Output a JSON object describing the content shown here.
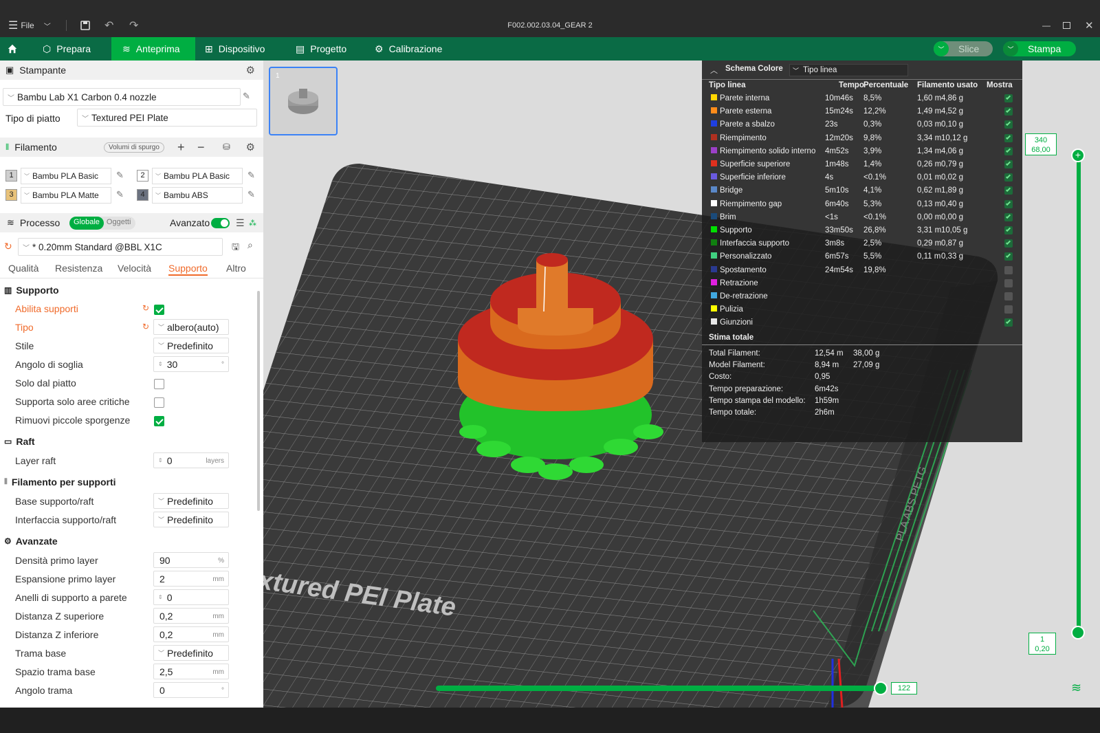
{
  "window": {
    "title": "F002.002.03.04_GEAR 2",
    "file_menu": "File"
  },
  "nav": {
    "tabs": [
      {
        "label": "Prepara",
        "icon": "cube-icon"
      },
      {
        "label": "Anteprima",
        "icon": "layers-icon",
        "active": true
      },
      {
        "label": "Dispositivo",
        "icon": "device-icon"
      },
      {
        "label": "Progetto",
        "icon": "project-icon"
      },
      {
        "label": "Calibrazione",
        "icon": "calibration-icon"
      }
    ],
    "slice_label": "Slice",
    "print_label": "Stampa"
  },
  "printer": {
    "section_title": "Stampante",
    "name": "Bambu Lab X1 Carbon 0.4 nozzle",
    "plate_label": "Tipo di piatto",
    "plate_value": "Textured PEI Plate"
  },
  "filament": {
    "section_title": "Filamento",
    "purge_label": "Volumi di spurgo",
    "slots": [
      {
        "num": "1",
        "name": "Bambu PLA Basic",
        "color": "#cfcfcf"
      },
      {
        "num": "2",
        "name": "Bambu PLA Basic",
        "color": "#ffffff"
      },
      {
        "num": "3",
        "name": "Bambu PLA Matte",
        "color": "#e8c27a"
      },
      {
        "num": "4",
        "name": "Bambu ABS",
        "color": "#6b7280"
      }
    ]
  },
  "process": {
    "section_title": "Processo",
    "toggle_global": "Globale",
    "toggle_objects": "Oggetti",
    "advanced_label": "Avanzato",
    "profile": "* 0.20mm Standard @BBL X1C",
    "tabs": [
      "Qualità",
      "Resistenza",
      "Velocità",
      "Supporto",
      "Altro"
    ],
    "active_tab": "Supporto"
  },
  "settings": {
    "supporto": {
      "title": "Supporto",
      "abilita": "Abilita supporti",
      "tipo": "Tipo",
      "tipo_value": "albero(auto)",
      "stile": "Stile",
      "stile_value": "Predefinito",
      "angolo": "Angolo di soglia",
      "angolo_value": "30",
      "angolo_unit": "°",
      "solo_piatto": "Solo dal piatto",
      "solo_critiche": "Supporta solo aree critiche",
      "rimuovi": "Rimuovi piccole sporgenze"
    },
    "raft": {
      "title": "Raft",
      "layer": "Layer raft",
      "layer_value": "0",
      "layer_unit": "layers"
    },
    "filamento_supporti": {
      "title": "Filamento per supporti",
      "base": "Base supporto/raft",
      "base_value": "Predefinito",
      "interfaccia": "Interfaccia supporto/raft",
      "interfaccia_value": "Predefinito"
    },
    "avanzate": {
      "title": "Avanzate",
      "densita": "Densità primo layer",
      "densita_value": "90",
      "densita_unit": "%",
      "espansione": "Espansione primo layer",
      "espansione_value": "2",
      "espansione_unit": "mm",
      "anelli": "Anelli di supporto a parete",
      "anelli_value": "0",
      "dist_sup": "Distanza Z superiore",
      "dist_sup_value": "0,2",
      "dist_sup_unit": "mm",
      "dist_inf": "Distanza Z inferiore",
      "dist_inf_value": "0,2",
      "dist_inf_unit": "mm",
      "trama": "Trama base",
      "trama_value": "Predefinito",
      "spazio": "Spazio trama base",
      "spazio_value": "2,5",
      "spazio_unit": "mm",
      "angolo_trama": "Angolo trama",
      "angolo_trama_value": "0",
      "angolo_trama_unit": "°"
    }
  },
  "viewport": {
    "plate_thumb_number": "1",
    "plate_text": "xtured PEI Plate",
    "plate_side_text": "PLA ABS PETG",
    "vslider_top": "340",
    "vslider_top_sub": "68,00",
    "vslider_bottom": "1",
    "vslider_bottom_sub": "0,20",
    "hslider_value": "122"
  },
  "legend": {
    "title": "Schema Colore",
    "mode": "Tipo linea",
    "headers": [
      "Tipo linea",
      "Tempo",
      "Percentuale",
      "Filamento usato",
      "Mostra"
    ],
    "rows": [
      {
        "name": "Parete interna",
        "color": "#ffd700",
        "time": "10m46s",
        "pct": "8,5%",
        "m": "1,60 m",
        "g": "4,86 g",
        "show": true
      },
      {
        "name": "Parete esterna",
        "color": "#ff8c1a",
        "time": "15m24s",
        "pct": "12,2%",
        "m": "1,49 m",
        "g": "4,52 g",
        "show": true
      },
      {
        "name": "Parete a sbalzo",
        "color": "#1f3fe0",
        "time": "23s",
        "pct": "0,3%",
        "m": "0,03 m",
        "g": "0,10 g",
        "show": true
      },
      {
        "name": "Riempimento",
        "color": "#b03020",
        "time": "12m20s",
        "pct": "9,8%",
        "m": "3,34 m",
        "g": "10,12 g",
        "show": true
      },
      {
        "name": "Riempimento solido interno",
        "color": "#9b40c8",
        "time": "4m52s",
        "pct": "3,9%",
        "m": "1,34 m",
        "g": "4,06 g",
        "show": true
      },
      {
        "name": "Superficie superiore",
        "color": "#e0301e",
        "time": "1m48s",
        "pct": "1,4%",
        "m": "0,26 m",
        "g": "0,79 g",
        "show": true
      },
      {
        "name": "Superficie inferiore",
        "color": "#6a5ae0",
        "time": "4s",
        "pct": "<0.1%",
        "m": "0,01 m",
        "g": "0,02 g",
        "show": true
      },
      {
        "name": "Bridge",
        "color": "#5a88c8",
        "time": "5m10s",
        "pct": "4,1%",
        "m": "0,62 m",
        "g": "1,89 g",
        "show": true
      },
      {
        "name": "Riempimento gap",
        "color": "#ffffff",
        "time": "6m40s",
        "pct": "5,3%",
        "m": "0,13 m",
        "g": "0,40 g",
        "show": true
      },
      {
        "name": "Brim",
        "color": "#1a4a7a",
        "time": "<1s",
        "pct": "<0.1%",
        "m": "0,00 m",
        "g": "0,00 g",
        "show": true
      },
      {
        "name": "Supporto",
        "color": "#00e000",
        "time": "33m50s",
        "pct": "26,8%",
        "m": "3,31 m",
        "g": "10,05 g",
        "show": true
      },
      {
        "name": "Interfaccia supporto",
        "color": "#108010",
        "time": "3m8s",
        "pct": "2,5%",
        "m": "0,29 m",
        "g": "0,87 g",
        "show": true
      },
      {
        "name": "Personalizzato",
        "color": "#40d080",
        "time": "6m57s",
        "pct": "5,5%",
        "m": "0,11 m",
        "g": "0,33 g",
        "show": true
      },
      {
        "name": "Spostamento",
        "color": "#2a3a90",
        "time": "24m54s",
        "pct": "19,8%",
        "m": "",
        "g": "",
        "show": false
      },
      {
        "name": "Retrazione",
        "color": "#e020e0",
        "time": "",
        "pct": "",
        "m": "",
        "g": "",
        "show": false
      },
      {
        "name": "De-retrazione",
        "color": "#40a8e0",
        "time": "",
        "pct": "",
        "m": "",
        "g": "",
        "show": false
      },
      {
        "name": "Pulizia",
        "color": "#ffff00",
        "time": "",
        "pct": "",
        "m": "",
        "g": "",
        "show": false
      },
      {
        "name": "Giunzioni",
        "color": "#e8e8e8",
        "time": "",
        "pct": "",
        "m": "",
        "g": "",
        "show": true
      }
    ],
    "totals_title": "Stima totale",
    "totals": [
      {
        "label": "Total Filament:",
        "v1": "12,54 m",
        "v2": "38,00 g"
      },
      {
        "label": "Model Filament:",
        "v1": "8,94 m",
        "v2": "27,09 g"
      },
      {
        "label": "Costo:",
        "v1": "0,95",
        "v2": ""
      },
      {
        "label": "Tempo preparazione:",
        "v1": "6m42s",
        "v2": ""
      },
      {
        "label": "Tempo stampa del modello:",
        "v1": "1h59m",
        "v2": ""
      },
      {
        "label": "Tempo totale:",
        "v1": "2h6m",
        "v2": ""
      }
    ]
  },
  "colors": {
    "brand": "#00ae42",
    "nav_bg": "#0a6b45",
    "orange": "#f06a2a"
  }
}
